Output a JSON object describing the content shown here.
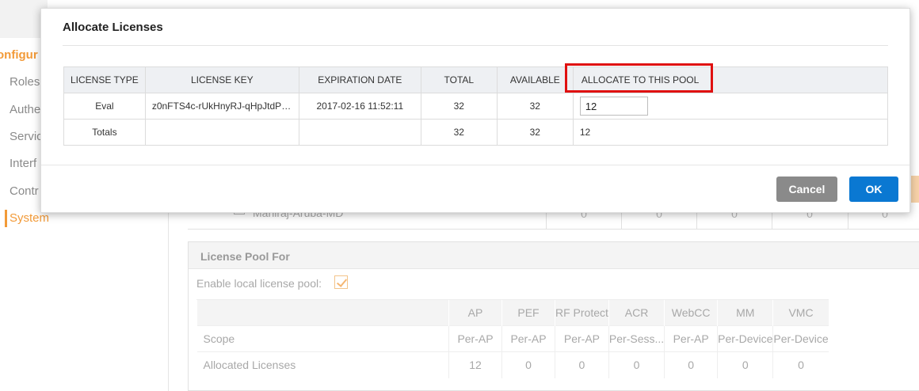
{
  "sidebar": {
    "configure_label": "onfigur",
    "items": [
      {
        "label": "Roles"
      },
      {
        "label": "Authe"
      },
      {
        "label": "Servic"
      },
      {
        "label": "Interf"
      },
      {
        "label": "Contr"
      },
      {
        "label": "System"
      }
    ],
    "active_item": "System"
  },
  "md_row": {
    "name": "Maniraj-Aruba-MD",
    "values": [
      "0",
      "0",
      "0",
      "0",
      "0"
    ]
  },
  "license_pool": {
    "title": "License Pool For",
    "enable_label": "Enable local license pool:",
    "enable_checked": true,
    "columns": [
      "AP",
      "PEF",
      "RF Protect",
      "ACR",
      "WebCC",
      "MM",
      "VMC"
    ],
    "rows": [
      {
        "label": "Scope",
        "values": [
          "Per-AP",
          "Per-AP",
          "Per-AP",
          "Per-Sess...",
          "Per-AP",
          "Per-Device",
          "Per-Device"
        ]
      },
      {
        "label": "Allocated Licenses",
        "values": [
          "12",
          "0",
          "0",
          "0",
          "0",
          "0",
          "0"
        ]
      }
    ]
  },
  "modal": {
    "title": "Allocate Licenses",
    "table": {
      "headers": {
        "license_type": "LICENSE TYPE",
        "license_key": "LICENSE KEY",
        "expiration_date": "EXPIRATION DATE",
        "total": "TOTAL",
        "available": "AVAILABLE",
        "allocate": "ALLOCATE TO THIS POOL"
      },
      "rows": [
        {
          "license_type": "Eval",
          "license_key": "z0nFTS4c-rUkHnyRJ-qHpJtdPK-...",
          "expiration_date": "2017-02-16 11:52:11",
          "total": "32",
          "available": "32",
          "allocate": "12"
        }
      ],
      "totals": {
        "label": "Totals",
        "license_key": "",
        "expiration_date": "",
        "total": "32",
        "available": "32",
        "allocate": "12"
      }
    },
    "buttons": {
      "cancel": "Cancel",
      "ok": "OK"
    },
    "colors": {
      "ok": "#0a78d2",
      "cancel": "#8a8a8a",
      "highlight": "#e01010",
      "accent": "#f29a38"
    }
  }
}
